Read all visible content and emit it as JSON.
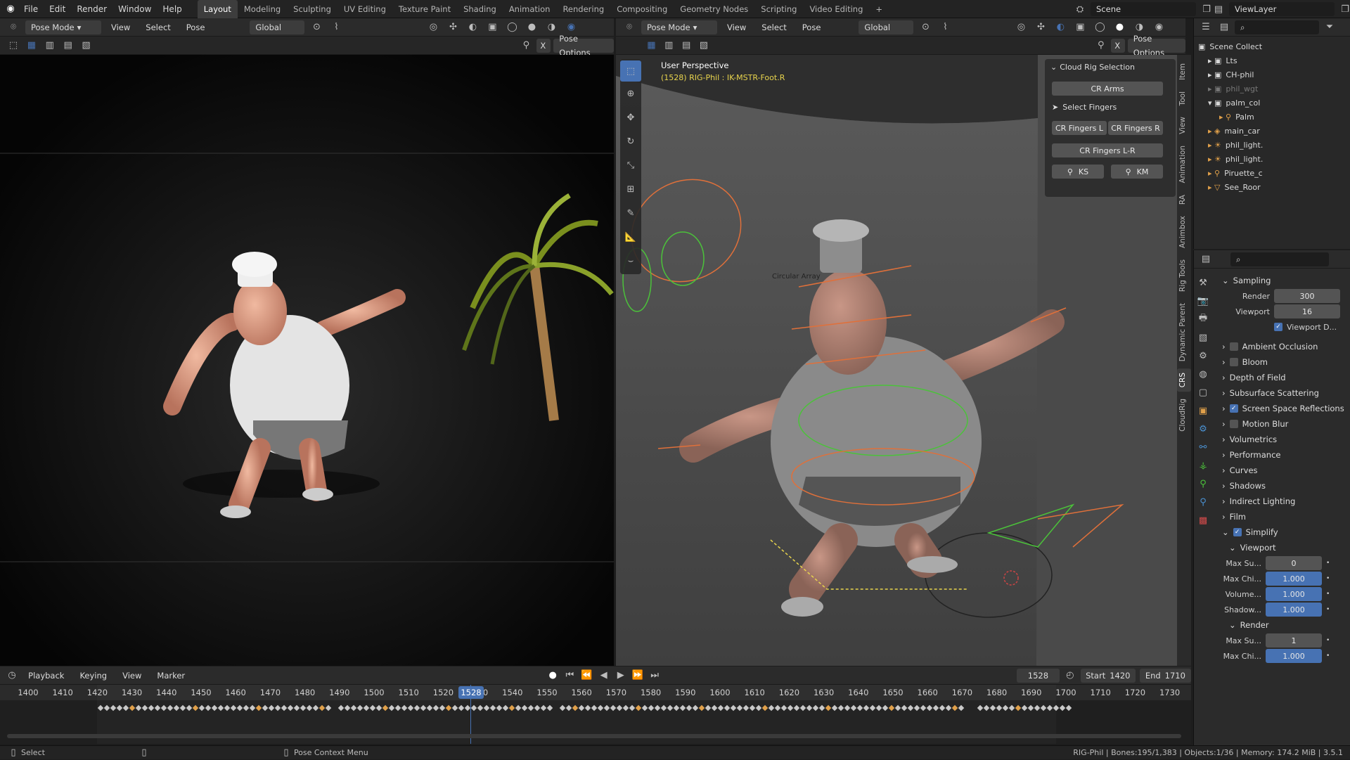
{
  "topbar": {
    "menus": [
      "File",
      "Edit",
      "Render",
      "Window",
      "Help"
    ],
    "workspaces": [
      "Layout",
      "Modeling",
      "Sculpting",
      "UV Editing",
      "Texture Paint",
      "Shading",
      "Animation",
      "Rendering",
      "Compositing",
      "Geometry Nodes",
      "Scripting",
      "Video Editing"
    ],
    "active_workspace": "Layout",
    "scene": "Scene",
    "view_layer": "ViewLayer"
  },
  "left_view": {
    "mode": "Pose Mode",
    "menus": [
      "View",
      "Select",
      "Pose"
    ],
    "orientation": "Global",
    "pose_options": "Pose Options",
    "x_label": "X"
  },
  "right_view": {
    "mode": "Pose Mode",
    "menus": [
      "View",
      "Select",
      "Pose"
    ],
    "orientation": "Global",
    "pose_options": "Pose Options",
    "x_label": "X",
    "overlay_title": "User Perspective",
    "overlay_sub": "(1528) RIG-Phil : IK-MSTR-Foot.R",
    "label_circular": "Circular Array"
  },
  "npanel": {
    "title": "Cloud Rig Selection",
    "cr_arms": "CR Arms",
    "select_fingers": "Select Fingers",
    "fingers_l": "CR Fingers L",
    "fingers_r": "CR Fingers R",
    "fingers_lr": "CR Fingers L-R",
    "ks": "KS",
    "km": "KM",
    "tabs": [
      "Item",
      "Tool",
      "View",
      "Animation",
      "RA",
      "Animbox",
      "Rig Tools",
      "Dynamic Parent",
      "CRS",
      "CloudRig"
    ],
    "active_tab": "CRS"
  },
  "outliner": {
    "title": "Scene Collect",
    "items": [
      "Lts",
      "CH-phil",
      "phil_wgt",
      "palm_col",
      "Palm",
      "main_car",
      "phil_light.",
      "phil_light.",
      "Piruette_c",
      "See_Roor"
    ]
  },
  "properties": {
    "sampling": "Sampling",
    "render_label": "Render",
    "render_value": "300",
    "viewport_label": "Viewport",
    "viewport_value": "16",
    "viewport_denoise": "Viewport D...",
    "sections": [
      "Ambient Occlusion",
      "Bloom",
      "Depth of Field",
      "Subsurface Scattering",
      "Screen Space Reflections",
      "Motion Blur",
      "Volumetrics",
      "Performance",
      "Curves",
      "Shadows",
      "Indirect Lighting",
      "Film"
    ],
    "simplify": "Simplify",
    "viewport_sub": "Viewport",
    "vp_rows": [
      {
        "label": "Max Su...",
        "value": "0"
      },
      {
        "label": "Max Chi...",
        "value": "1.000"
      },
      {
        "label": "Volume...",
        "value": "1.000"
      },
      {
        "label": "Shadow...",
        "value": "1.000"
      }
    ],
    "render_sub": "Render",
    "r_rows": [
      {
        "label": "Max Su...",
        "value": "1"
      },
      {
        "label": "Max Chi...",
        "value": "1.000"
      }
    ]
  },
  "timeline": {
    "menus": [
      "Playback",
      "Keying",
      "View",
      "Marker"
    ],
    "current_frame": "1528",
    "start_label": "Start",
    "start": "1420",
    "end_label": "End",
    "end": "1710",
    "ticks": [
      "1400",
      "1410",
      "1420",
      "1430",
      "1440",
      "1450",
      "1460",
      "1470",
      "1480",
      "1490",
      "1500",
      "1510",
      "1520",
      "1530",
      "1540",
      "1550",
      "1560",
      "1570",
      "1580",
      "1590",
      "1600",
      "1610",
      "1620",
      "1630",
      "1640",
      "1650",
      "1660",
      "1670",
      "1680",
      "1690",
      "1700",
      "1710",
      "1720",
      "1730"
    ]
  },
  "status": {
    "left": "Select",
    "middle": "Pose Context Menu",
    "right": "RIG-Phil | Bones:195/1,383 | Objects:1/36 | Memory: 174.2 MiB | 3.5.1"
  },
  "colors": {
    "accent": "#4772b3",
    "active_bone": "#ffa028",
    "highlight_text": "#e8d44d"
  }
}
